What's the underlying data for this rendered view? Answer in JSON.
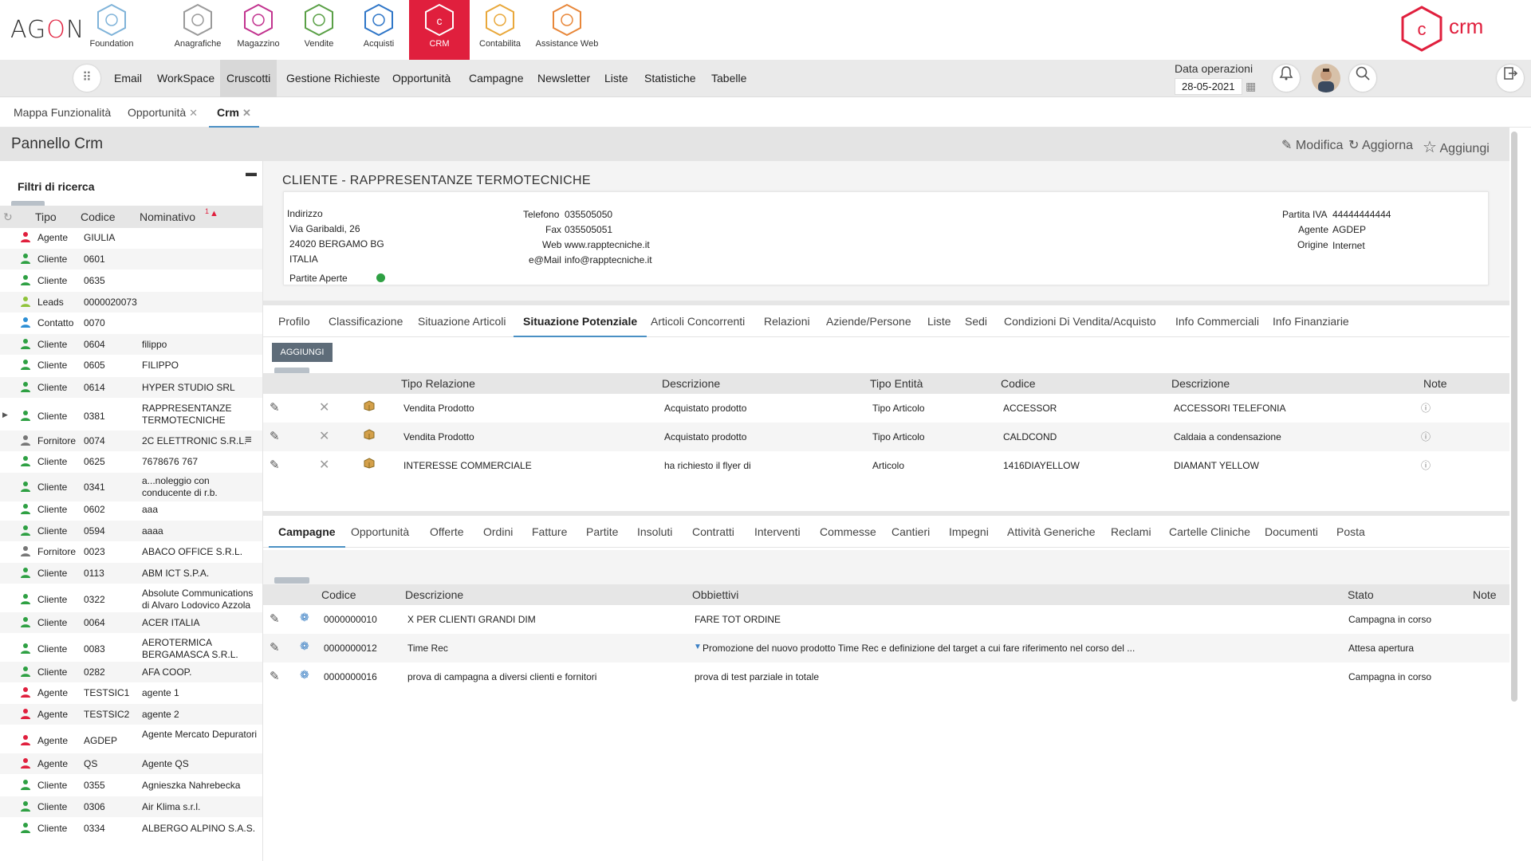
{
  "app": {
    "logo": "AGON",
    "brand": "crm",
    "modules": [
      {
        "label": "Foundation",
        "color": "#7fb3d9"
      },
      {
        "label": "Anagrafiche",
        "color": "#9a9a9a"
      },
      {
        "label": "Magazzino",
        "color": "#c2338f"
      },
      {
        "label": "Vendite",
        "color": "#5aa046"
      },
      {
        "label": "Acquisti",
        "color": "#2f76c8"
      },
      {
        "label": "CRM",
        "color": "#ffffff"
      },
      {
        "label": "Contabilita",
        "color": "#e9a83b"
      },
      {
        "label": "Assistance Web",
        "color": "#e8873a"
      }
    ],
    "accent": "#e01f3d"
  },
  "menu": {
    "items": [
      "Email",
      "WorkSpace",
      "Cruscotti",
      "Gestione Richieste",
      "Opportunità",
      "Campagne",
      "Newsletter",
      "Liste",
      "Statistiche",
      "Tabelle"
    ],
    "selected": "Cruscotti",
    "data_operazioni_label": "Data operazioni",
    "data_operazioni_value": "28-05-2021"
  },
  "page_tabs": [
    {
      "label": "Mappa Funzionalità",
      "closable": false
    },
    {
      "label": "Opportunità",
      "closable": true
    },
    {
      "label": "Crm",
      "closable": true,
      "selected": true
    }
  ],
  "panel": {
    "title": "Pannello Crm",
    "modifica": "Modifica",
    "aggiorna": "Aggiorna",
    "aggiungi": "Aggiungi"
  },
  "filters": {
    "title": "Filtri di ricerca",
    "columns": {
      "tipo": "Tipo",
      "codice": "Codice",
      "nominativo": "Nominativo",
      "sort_index": "1"
    },
    "rows": [
      {
        "tipo": "Agente",
        "codice": "GIULIA",
        "nominativo": "",
        "icon_color": "#e01f3d"
      },
      {
        "tipo": "Cliente",
        "codice": "0601",
        "nominativo": "",
        "icon_color": "#2ea043"
      },
      {
        "tipo": "Cliente",
        "codice": "0635",
        "nominativo": "",
        "icon_color": "#2ea043"
      },
      {
        "tipo": "Leads",
        "codice": "0000020073",
        "nominativo": "",
        "icon_color": "#8fc33a"
      },
      {
        "tipo": "Contatto",
        "codice": "0070",
        "nominativo": "",
        "icon_color": "#2d8fd5"
      },
      {
        "tipo": "Cliente",
        "codice": "0604",
        "nominativo": "filippo",
        "icon_color": "#2ea043"
      },
      {
        "tipo": "Cliente",
        "codice": "0605",
        "nominativo": "FILIPPO",
        "icon_color": "#2ea043"
      },
      {
        "tipo": "Cliente",
        "codice": "0614",
        "nominativo": "HYPER STUDIO SRL",
        "icon_color": "#2ea043"
      },
      {
        "tipo": "Cliente",
        "codice": "0381",
        "nominativo": "RAPPRESENTANZE TERMOTECNICHE",
        "icon_color": "#2ea043"
      },
      {
        "tipo": "Fornitore",
        "codice": "0074",
        "nominativo": "2C ELETTRONIC S.R.L.",
        "icon_color": "#777777"
      },
      {
        "tipo": "Cliente",
        "codice": "0625",
        "nominativo": "7678676 767",
        "icon_color": "#2ea043"
      },
      {
        "tipo": "Cliente",
        "codice": "0341",
        "nominativo": "a...noleggio con conducente di r.b.",
        "icon_color": "#2ea043"
      },
      {
        "tipo": "Cliente",
        "codice": "0602",
        "nominativo": "aaa",
        "icon_color": "#2ea043"
      },
      {
        "tipo": "Cliente",
        "codice": "0594",
        "nominativo": "aaaa",
        "icon_color": "#2ea043"
      },
      {
        "tipo": "Fornitore",
        "codice": "0023",
        "nominativo": "ABACO OFFICE S.R.L.",
        "icon_color": "#777777"
      },
      {
        "tipo": "Cliente",
        "codice": "0113",
        "nominativo": "ABM ICT S.P.A.",
        "icon_color": "#2ea043"
      },
      {
        "tipo": "Cliente",
        "codice": "0322",
        "nominativo": "Absolute Communications di Alvaro Lodovico Azzola",
        "icon_color": "#2ea043"
      },
      {
        "tipo": "Cliente",
        "codice": "0064",
        "nominativo": "ACER ITALIA",
        "icon_color": "#2ea043"
      },
      {
        "tipo": "Cliente",
        "codice": "0083",
        "nominativo": "AEROTERMICA BERGAMASCA S.R.L.",
        "icon_color": "#2ea043"
      },
      {
        "tipo": "Cliente",
        "codice": "0282",
        "nominativo": "AFA COOP.",
        "icon_color": "#2ea043"
      },
      {
        "tipo": "Agente",
        "codice": "TESTSIC1",
        "nominativo": "agente 1",
        "icon_color": "#e01f3d"
      },
      {
        "tipo": "Agente",
        "codice": "TESTSIC2",
        "nominativo": "agente 2",
        "icon_color": "#e01f3d"
      },
      {
        "tipo": "Agente",
        "codice": "AGDEP",
        "nominativo": "Agente Mercato Depuratori",
        "icon_color": "#e01f3d"
      },
      {
        "tipo": "Agente",
        "codice": "QS",
        "nominativo": "Agente QS",
        "icon_color": "#e01f3d"
      },
      {
        "tipo": "Cliente",
        "codice": "0355",
        "nominativo": "Agnieszka Nahrebecka",
        "icon_color": "#2ea043"
      },
      {
        "tipo": "Cliente",
        "codice": "0306",
        "nominativo": "Air Klima s.r.l.",
        "icon_color": "#2ea043"
      },
      {
        "tipo": "Cliente",
        "codice": "0334",
        "nominativo": "ALBERGO ALPINO S.A.S.",
        "icon_color": "#2ea043"
      }
    ]
  },
  "customer": {
    "title": "CLIENTE - RAPPRESENTANZE TERMOTECNICHE",
    "indirizzo_label": "Indirizzo",
    "address1": "Via Garibaldi, 26",
    "address2": "24020 BERGAMO BG",
    "address3": "ITALIA",
    "partite_aperte_label": "Partite Aperte",
    "telefono_label": "Telefono",
    "telefono": "035505050",
    "fax_label": "Fax",
    "fax": "035505051",
    "web_label": "Web",
    "web": "www.rapptecniche.it",
    "email_label": "e@Mail",
    "email": "info@rapptecniche.it",
    "piva_label": "Partita IVA",
    "piva": "44444444444",
    "agente_label": "Agente",
    "agente": "AGDEP",
    "origine_label": "Origine",
    "origine": "Internet"
  },
  "tabs1": {
    "items": [
      "Profilo",
      "Classificazione",
      "Situazione Articoli",
      "Situazione Potenziale",
      "Articoli Concorrenti",
      "Relazioni",
      "Aziende/Persone",
      "Liste",
      "Sedi",
      "Condizioni Di Vendita/Acquisto",
      "Info Commerciali",
      "Info Finanziarie"
    ],
    "selected": "Situazione Potenziale"
  },
  "potenziale": {
    "add_button": "AGGIUNGI",
    "columns": {
      "tipo_relazione": "Tipo Relazione",
      "descrizione": "Descrizione",
      "tipo_entita": "Tipo Entità",
      "codice": "Codice",
      "descrizione2": "Descrizione",
      "note": "Note"
    },
    "rows": [
      {
        "tipo_relazione": "Vendita Prodotto",
        "descrizione": "Acquistato prodotto",
        "tipo_entita": "Tipo Articolo",
        "codice": "ACCESSOR",
        "descrizione2": "ACCESSORI TELEFONIA"
      },
      {
        "tipo_relazione": "Vendita Prodotto",
        "descrizione": "Acquistato prodotto",
        "tipo_entita": "Tipo Articolo",
        "codice": "CALDCOND",
        "descrizione2": "Caldaia a condensazione"
      },
      {
        "tipo_relazione": "INTERESSE COMMERCIALE",
        "descrizione": "ha richiesto il flyer di",
        "tipo_entita": "Articolo",
        "codice": "1416DIAYELLOW",
        "descrizione2": "DIAMANT YELLOW"
      }
    ]
  },
  "tabs2": {
    "items": [
      "Campagne",
      "Opportunità",
      "Offerte",
      "Ordini",
      "Fatture",
      "Partite",
      "Insoluti",
      "Contratti",
      "Interventi",
      "Commesse",
      "Cantieri",
      "Impegni",
      "Attività Generiche",
      "Reclami",
      "Cartelle Cliniche",
      "Documenti",
      "Posta"
    ],
    "selected": "Campagne"
  },
  "campagne": {
    "columns": {
      "codice": "Codice",
      "descrizione": "Descrizione",
      "obbiettivi": "Obbiettivi",
      "stato": "Stato",
      "note": "Note"
    },
    "rows": [
      {
        "codice": "0000000010",
        "descrizione": "X PER CLIENTI GRANDI DIM",
        "obbiettivi": "FARE TOT ORDINE",
        "stato": "Campagna in corso"
      },
      {
        "codice": "0000000012",
        "descrizione": "Time Rec",
        "obbiettivi": "Promozione del nuovo prodotto Time Rec e definizione del target a cui fare riferimento nel corso del ...",
        "stato": "Attesa apertura"
      },
      {
        "codice": "0000000016",
        "descrizione": "prova di campagna a diversi clienti e fornitori",
        "obbiettivi": "prova di test parziale in totale",
        "stato": "Campagna in corso"
      }
    ]
  }
}
